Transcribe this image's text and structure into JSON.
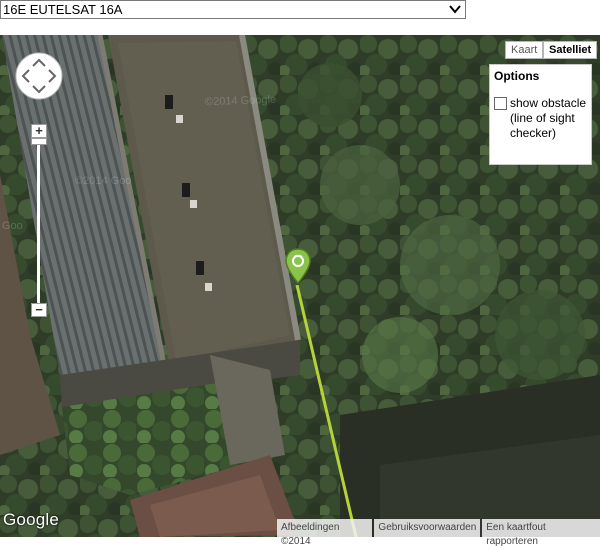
{
  "satellite_select": {
    "value": "16E EUTELSAT 16A"
  },
  "map": {
    "type_buttons": [
      {
        "label": "Kaart",
        "active": false
      },
      {
        "label": "Satelliet",
        "active": true
      }
    ],
    "options_panel": {
      "title": "Options",
      "checkbox_label": "show obstacle (line of sight checker)",
      "checked": false
    },
    "zoom": {
      "plus": "+",
      "minus": "−"
    },
    "logo": "Google",
    "watermarks": [
      "©2014 Google",
      "©2014 Goo",
      "Goo"
    ],
    "footer": {
      "imagery": "Afbeeldingen ©2014",
      "terms": "Gebruiksvoorwaarden",
      "report": "Een kaartfout rapporteren"
    },
    "colors": {
      "line_of_sight": "#b5d23a",
      "marker": "#8bc34a"
    }
  }
}
